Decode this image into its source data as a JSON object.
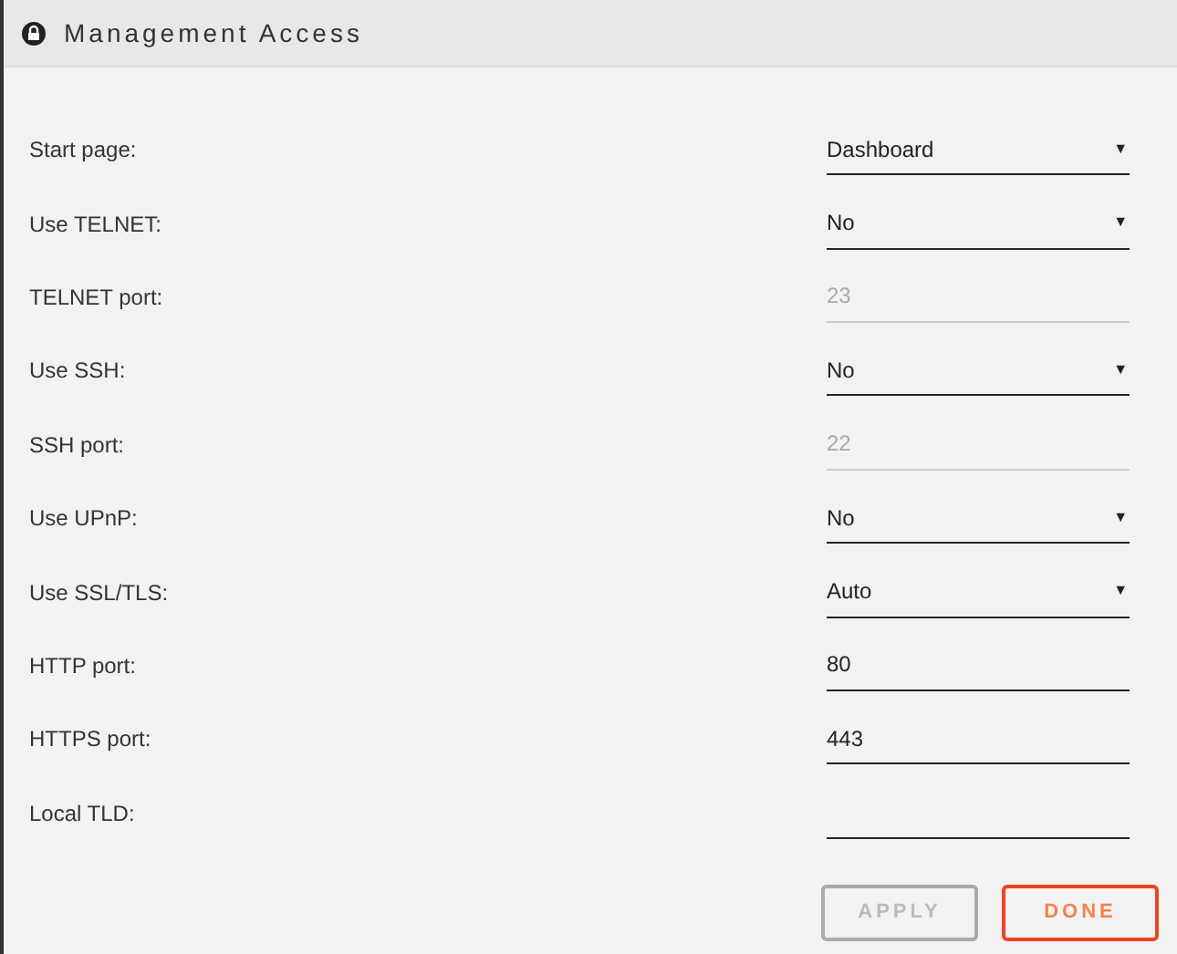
{
  "header": {
    "title": "Management Access"
  },
  "fields": [
    {
      "label": "Start page:",
      "kind": "select",
      "value": "Dashboard",
      "disabled": false,
      "caret": "▼"
    },
    {
      "label": "Use TELNET:",
      "kind": "select",
      "value": "No",
      "disabled": false,
      "caret": "▼"
    },
    {
      "label": "TELNET port:",
      "kind": "text",
      "value": "23",
      "disabled": true
    },
    {
      "label": "Use SSH:",
      "kind": "select",
      "value": "No",
      "disabled": false,
      "caret": "▼"
    },
    {
      "label": "SSH port:",
      "kind": "text",
      "value": "22",
      "disabled": true
    },
    {
      "label": "Use UPnP:",
      "kind": "select",
      "value": "No",
      "disabled": false,
      "caret": "▼"
    },
    {
      "label": "Use SSL/TLS:",
      "kind": "select",
      "value": "Auto",
      "disabled": false,
      "caret": "▼"
    },
    {
      "label": "HTTP port:",
      "kind": "text",
      "value": "80",
      "disabled": false
    },
    {
      "label": "HTTPS port:",
      "kind": "text",
      "value": "443",
      "disabled": false
    },
    {
      "label": "Local TLD:",
      "kind": "text",
      "disabled": false
    }
  ],
  "buttons": [
    {
      "label": "APPLY",
      "disabled": true
    },
    {
      "label": "DONE",
      "disabled": false
    }
  ]
}
